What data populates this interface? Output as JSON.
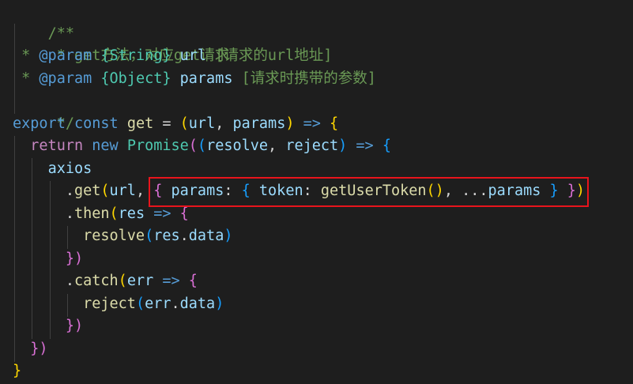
{
  "colors": {
    "background": "#1e1e1e",
    "comment": "#6a9955",
    "keyword": "#569cd6",
    "control": "#c586c0",
    "variable": "#9cdcfe",
    "function": "#dcdcaa",
    "class": "#4ec9b0",
    "operator": "#d4d4d4",
    "bracket_level1": "#ffd700",
    "bracket_level2": "#da70d6",
    "bracket_level3": "#179fff",
    "highlight_box": "#e8141c"
  },
  "code": {
    "l1": {
      "t1": "/**"
    },
    "l2": {
      "t1": " * get方法，对应get请求"
    },
    "l3": {
      "t1": " * ",
      "t2": "@param",
      "t3": " ",
      "t4": "{String}",
      "t5": " ",
      "t6": "url",
      "t7": " [请求的url地址]"
    },
    "l4": {
      "t1": " * ",
      "t2": "@param",
      "t3": " ",
      "t4": "{Object}",
      "t5": " ",
      "t6": "params",
      "t7": " [请求时携带的参数]"
    },
    "l5": {
      "t1": " */"
    },
    "l6": {
      "t1": "export",
      "t2": " ",
      "t3": "const",
      "t4": " ",
      "t5": "get",
      "t6": " = ",
      "t7": "(",
      "t8": "url",
      "t9": ", ",
      "t10": "params",
      "t11": ")",
      "t12": " ",
      "t13": "=>",
      "t14": " ",
      "t15": "{"
    },
    "l7": {
      "t1": "  ",
      "t2": "return",
      "t3": " ",
      "t4": "new",
      "t5": " ",
      "t6": "Promise",
      "t7": "(",
      "t8": "(",
      "t9": "resolve",
      "t10": ", ",
      "t11": "reject",
      "t12": ")",
      "t13": " ",
      "t14": "=>",
      "t15": " ",
      "t16": "{"
    },
    "l8": {
      "t1": "    ",
      "t2": "axios"
    },
    "l9": {
      "t1": "      .",
      "t2": "get",
      "t3": "(",
      "t4": "url",
      "t5": ", ",
      "t6": "{",
      "t7": " ",
      "t8": "params",
      "t9": ": ",
      "t10": "{",
      "t11": " ",
      "t12": "token",
      "t13": ": ",
      "t14": "getUserToken",
      "t15": "()",
      "t16": ", ...",
      "t17": "params",
      "t18": " ",
      "t19": "}",
      "t20": " ",
      "t21": "}",
      "t22": ")"
    },
    "l10": {
      "t1": "      .",
      "t2": "then",
      "t3": "(",
      "t4": "res",
      "t5": " ",
      "t6": "=>",
      "t7": " ",
      "t8": "{"
    },
    "l11": {
      "t1": "        ",
      "t2": "resolve",
      "t3": "(",
      "t4": "res",
      "t5": ".",
      "t6": "data",
      "t7": ")"
    },
    "l12": {
      "t1": "      ",
      "t2": "})"
    },
    "l13": {
      "t1": "      .",
      "t2": "catch",
      "t3": "(",
      "t4": "err",
      "t5": " ",
      "t6": "=>",
      "t7": " ",
      "t8": "{"
    },
    "l14": {
      "t1": "        ",
      "t2": "reject",
      "t3": "(",
      "t4": "err",
      "t5": ".",
      "t6": "data",
      "t7": ")"
    },
    "l15": {
      "t1": "      ",
      "t2": "})"
    },
    "l16": {
      "t1": "  ",
      "t2": "})"
    },
    "l17": {
      "t1": "}"
    }
  }
}
